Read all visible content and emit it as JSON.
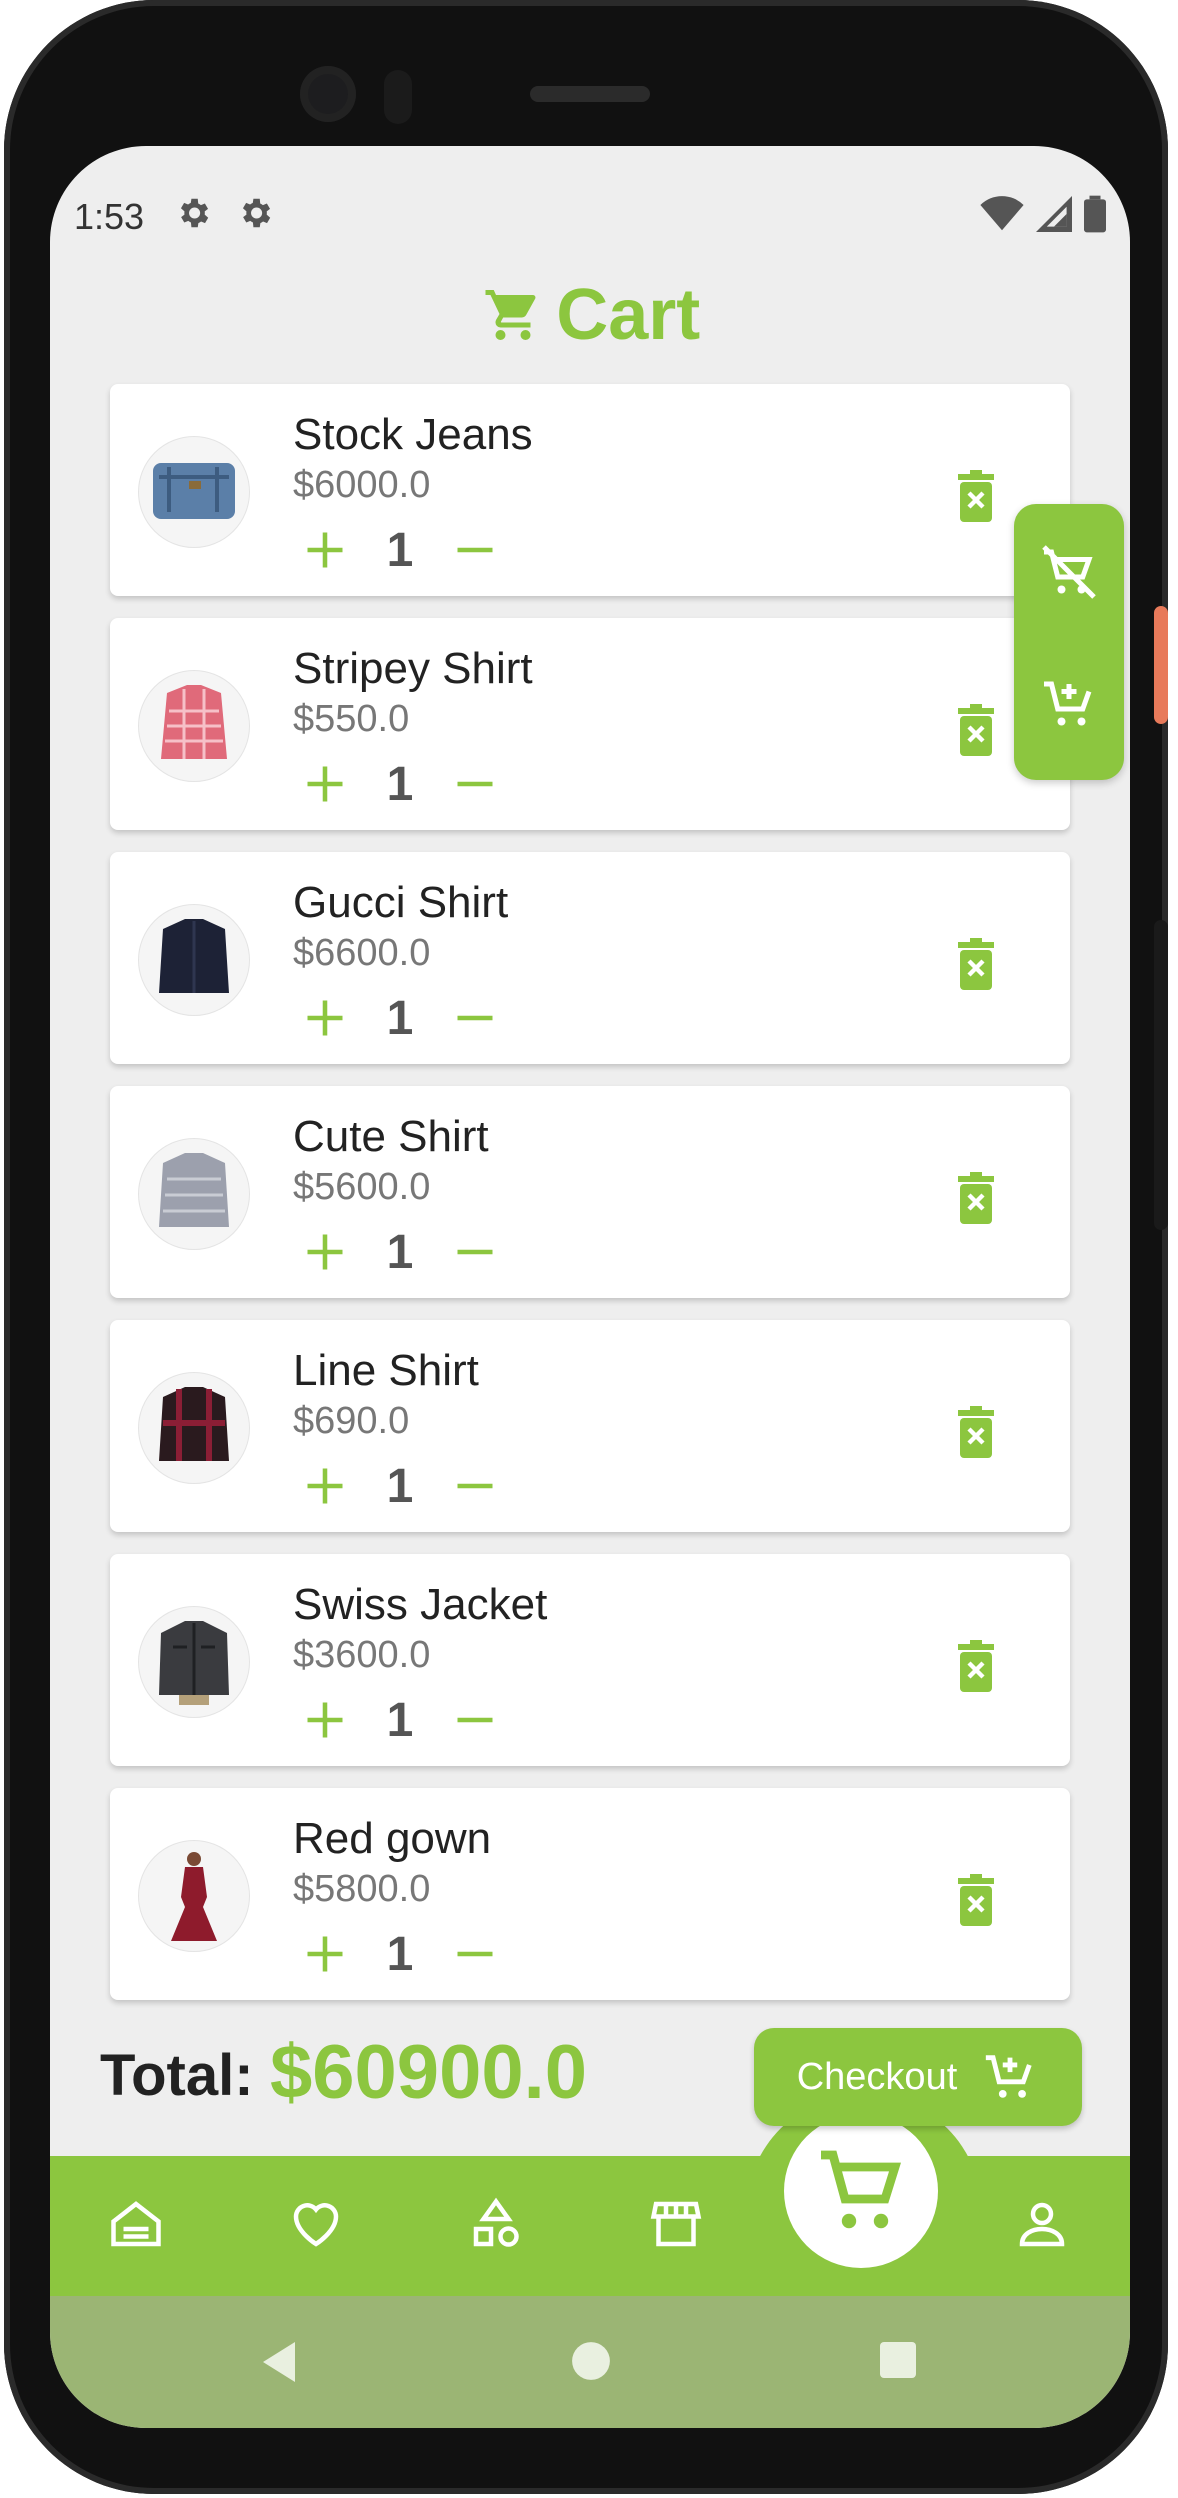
{
  "status_bar": {
    "time": "1:53"
  },
  "header": {
    "title": "Cart"
  },
  "cart_items": [
    {
      "name": "Stock Jeans",
      "price": "$6000.0",
      "qty": "1",
      "thumb": "jeans"
    },
    {
      "name": "Stripey Shirt",
      "price": "$550.0",
      "qty": "1",
      "thumb": "shirt-red-check"
    },
    {
      "name": "Gucci Shirt",
      "price": "$6600.0",
      "qty": "1",
      "thumb": "shirt-navy"
    },
    {
      "name": "Cute Shirt",
      "price": "$5600.0",
      "qty": "1",
      "thumb": "shirt-grey"
    },
    {
      "name": "Line Shirt",
      "price": "$690.0",
      "qty": "1",
      "thumb": "shirt-maroon"
    },
    {
      "name": "Swiss Jacket",
      "price": "$3600.0",
      "qty": "1",
      "thumb": "jacket"
    },
    {
      "name": "Red gown",
      "price": "$5800.0",
      "qty": "1",
      "thumb": "gown"
    }
  ],
  "summary": {
    "total_label": "Total:",
    "total_value": "$60900.0"
  },
  "checkout": {
    "label": "Checkout"
  },
  "bottom_nav": [
    "home-icon",
    "heart-icon",
    "categories-icon",
    "store-icon",
    "cart-icon",
    "profile-icon"
  ],
  "colors": {
    "accent": "#8cc63f",
    "background": "#eeeeee",
    "system_nav": "#9bb574"
  }
}
